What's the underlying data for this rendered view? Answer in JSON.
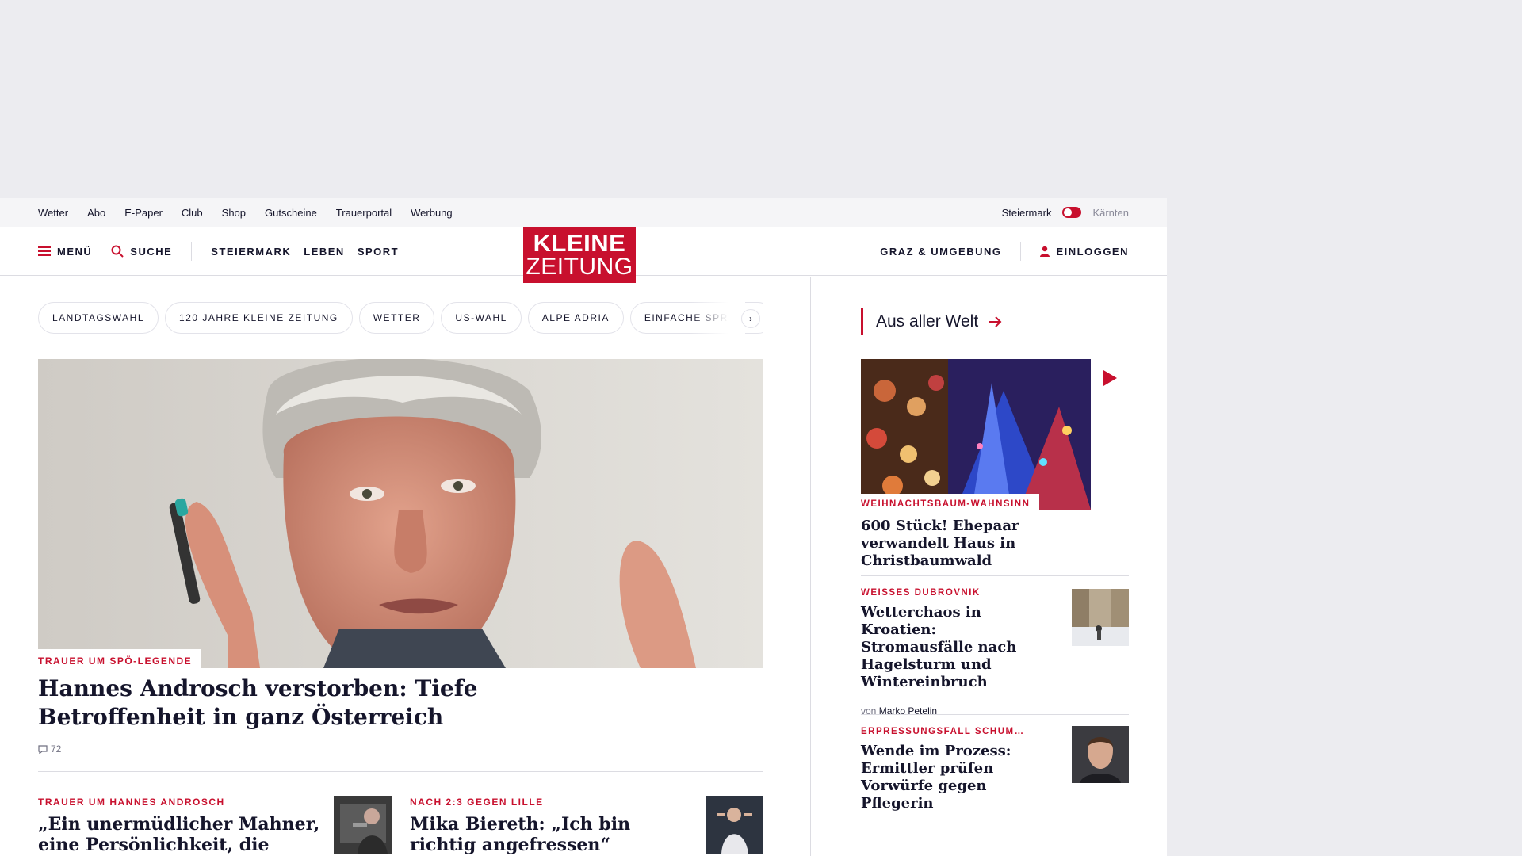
{
  "utility_nav": {
    "links": [
      "Wetter",
      "Abo",
      "E-Paper",
      "Club",
      "Shop",
      "Gutscheine",
      "Trauerportal",
      "Werbung"
    ],
    "region_active": "Steiermark",
    "region_inactive": "Kärnten"
  },
  "main_nav": {
    "menu_label": "MENÜ",
    "search_label": "SUCHE",
    "sections": [
      "STEIERMARK",
      "LEBEN",
      "SPORT"
    ],
    "local_label": "GRAZ & UMGEBUNG",
    "login_label": "EINLOGGEN"
  },
  "logo": {
    "line1": "KLEINE",
    "line2": "ZEITUNG"
  },
  "topic_chips": [
    "LANDTAGSWAHL",
    "120 JAHRE KLEINE ZEITUNG",
    "WETTER",
    "US-WAHL",
    "ALPE ADRIA",
    "EINFACHE SPRACHE"
  ],
  "hero": {
    "kicker": "TRAUER UM SPÖ-LEGENDE",
    "title": "Hannes Androsch verstorben: Tiefe Betroffenheit in ganz Österreich",
    "comment_count": "72"
  },
  "teasers": [
    {
      "kicker": "TRAUER UM HANNES ANDROSCH",
      "title": "„Ein unermüdlicher Mahner, eine Persönlichkeit, die fehlen wird“"
    },
    {
      "kicker": "NACH 2:3 GEGEN LILLE",
      "title": "Mika Biereth: „Ich bin richtig angefressen“"
    }
  ],
  "sidebar": {
    "section_title": "Aus aller Welt",
    "featured": {
      "kicker": "WEIHNACHTSBAUM-WAHNSINN",
      "title": "600 Stück! Ehepaar verwandelt Haus in Christbaumwald"
    },
    "articles": [
      {
        "kicker": "WEISSES DUBROVNIK",
        "title": "Wetterchaos in Kroatien: Stromausfälle nach Hagelsturm und Wintereinbruch",
        "byline_prefix": "von",
        "author": "Marko Petelin"
      },
      {
        "kicker": "ERPRESSUNGSFALL SCHUM…",
        "title": "Wende im Prozess: Ermittler prüfen Vorwürfe gegen Pflegerin"
      }
    ]
  },
  "colors": {
    "brand_red": "#c8102e",
    "text": "#15152b",
    "ad_background": "#ececf0"
  }
}
